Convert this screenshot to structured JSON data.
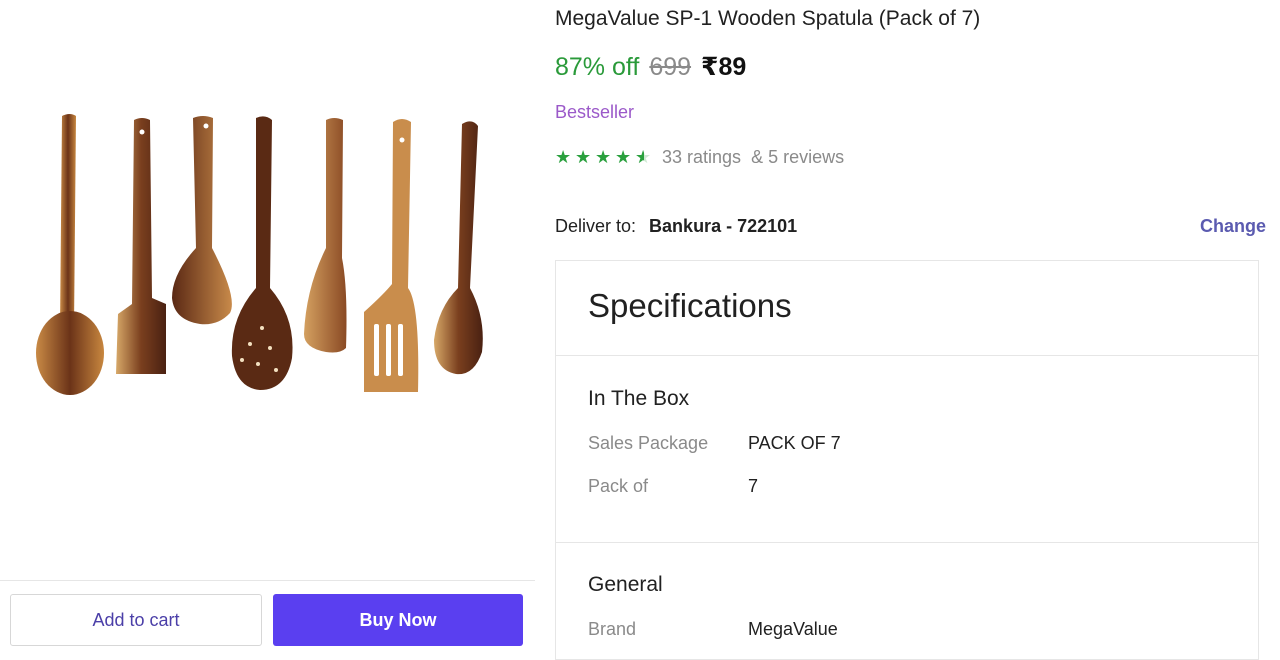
{
  "product": {
    "title": "MegaValue SP-1 Wooden Spatula (Pack of 7)",
    "discount": "87% off",
    "mrp": "699",
    "price": "₹89",
    "badge": "Bestseller",
    "rating_value": 4.5,
    "ratings_count": "33 ratings",
    "reviews_count": "& 5 reviews"
  },
  "delivery": {
    "label": "Deliver to:",
    "location": "Bankura - 722101",
    "change_label": "Change"
  },
  "actions": {
    "add_to_cart": "Add to cart",
    "buy_now": "Buy Now"
  },
  "specifications": {
    "title": "Specifications",
    "groups": [
      {
        "name": "In The Box",
        "rows": [
          {
            "key": "Sales Package",
            "value": "PACK OF 7"
          },
          {
            "key": "Pack of",
            "value": "7"
          }
        ]
      },
      {
        "name": "General",
        "rows": [
          {
            "key": "Brand",
            "value": "MegaValue"
          }
        ]
      }
    ]
  },
  "colors": {
    "accent": "#5a3ff0",
    "discount_green": "#2a9a3a",
    "badge_purple": "#9b59c9",
    "star_green": "#2aa03e"
  }
}
